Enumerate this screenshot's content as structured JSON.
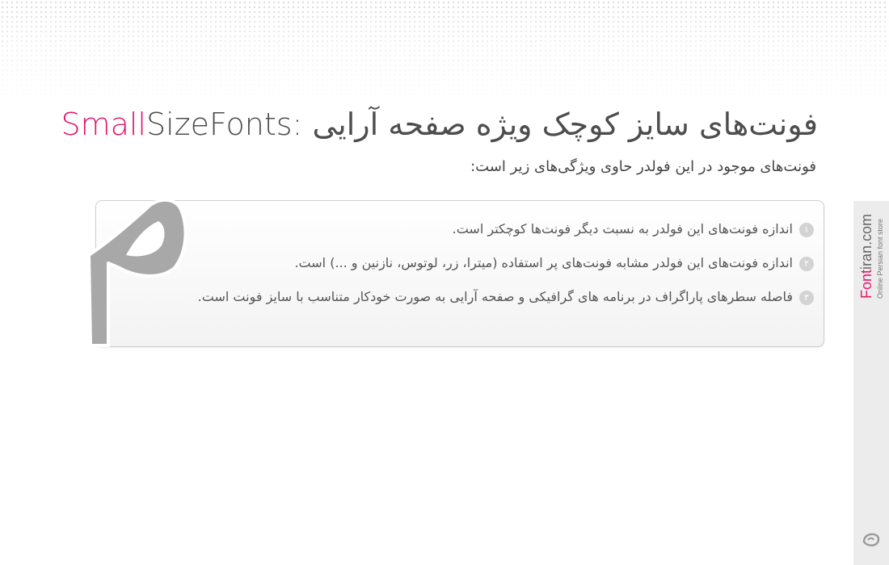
{
  "header": {
    "title_accent": "Small",
    "title_rest": "SizeFonts",
    "title_sep": ":",
    "title_fa": "فونت‌های سایز کوچک ویژه صفحه آرایی",
    "subtitle": "فونت‌های موجود در این فولدر حاوی ویژگی‌های زیر است:"
  },
  "features": [
    {
      "num": "۱",
      "text": "اندازه فونت‌های این فولدر به نسبت دیگر فونت‌ها کوچکتر است."
    },
    {
      "num": "۲",
      "text": "اندازه فونت‌های این فولدر مشابه فونت‌های پر استفاده (میترا، زر، لوتوس، نازنین و ...) است."
    },
    {
      "num": "۳",
      "text": "فاصله سطرهای پاراگراف در برنامه های گرافیکی و صفحه آرایی به صورت خودکار متناسب با سایز فونت است."
    }
  ],
  "big_letter": "م",
  "sidebar": {
    "brand_accent": "Font",
    "brand_rest": "iran.com",
    "tagline": "Online Persian font store"
  },
  "colors": {
    "accent": "#e3166d",
    "text": "#4d4d4d",
    "side_tab": "#ececec",
    "big_letter": "#a8a8a8"
  }
}
